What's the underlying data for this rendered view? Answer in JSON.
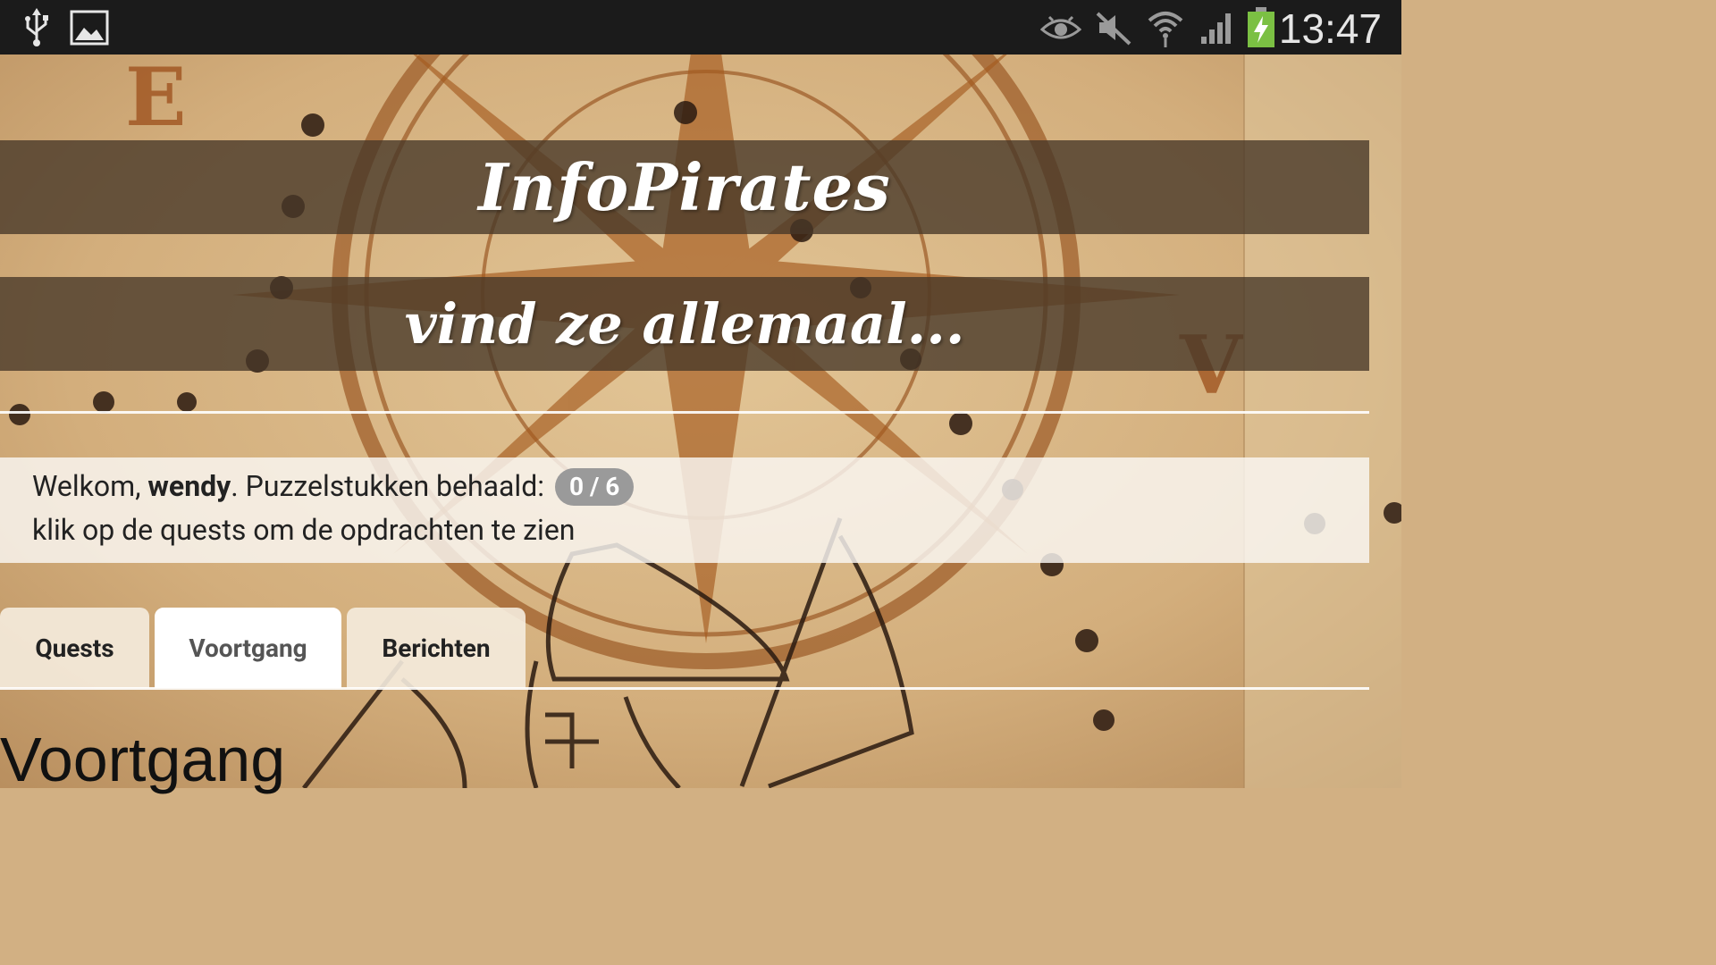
{
  "status_bar": {
    "left_icons": [
      "usb-icon",
      "image-icon"
    ],
    "right_icons": [
      "eye-icon",
      "mute-icon",
      "wifi-icon",
      "signal-icon",
      "battery-charging-icon"
    ],
    "time": "13:47"
  },
  "banner": {
    "title": "InfoPirates",
    "subtitle": "vind ze allemaal..."
  },
  "welcome": {
    "greeting": "Welkom, ",
    "username": "wendy",
    "progress_label": ". Puzzelstukken behaald: ",
    "progress_badge": "0 / 6",
    "instruction": "klik op de quests om de opdrachten te zien"
  },
  "tabs": [
    {
      "label": "Quests",
      "active": false
    },
    {
      "label": "Voortgang",
      "active": true
    },
    {
      "label": "Berichten",
      "active": false
    }
  ],
  "section_heading": "Voortgang",
  "colors": {
    "status_bar": "#1b1b1b",
    "banner_overlay": "#463728",
    "parchment": "#d2b083",
    "badge": "#9a9a9a",
    "battery": "#7bc043"
  }
}
